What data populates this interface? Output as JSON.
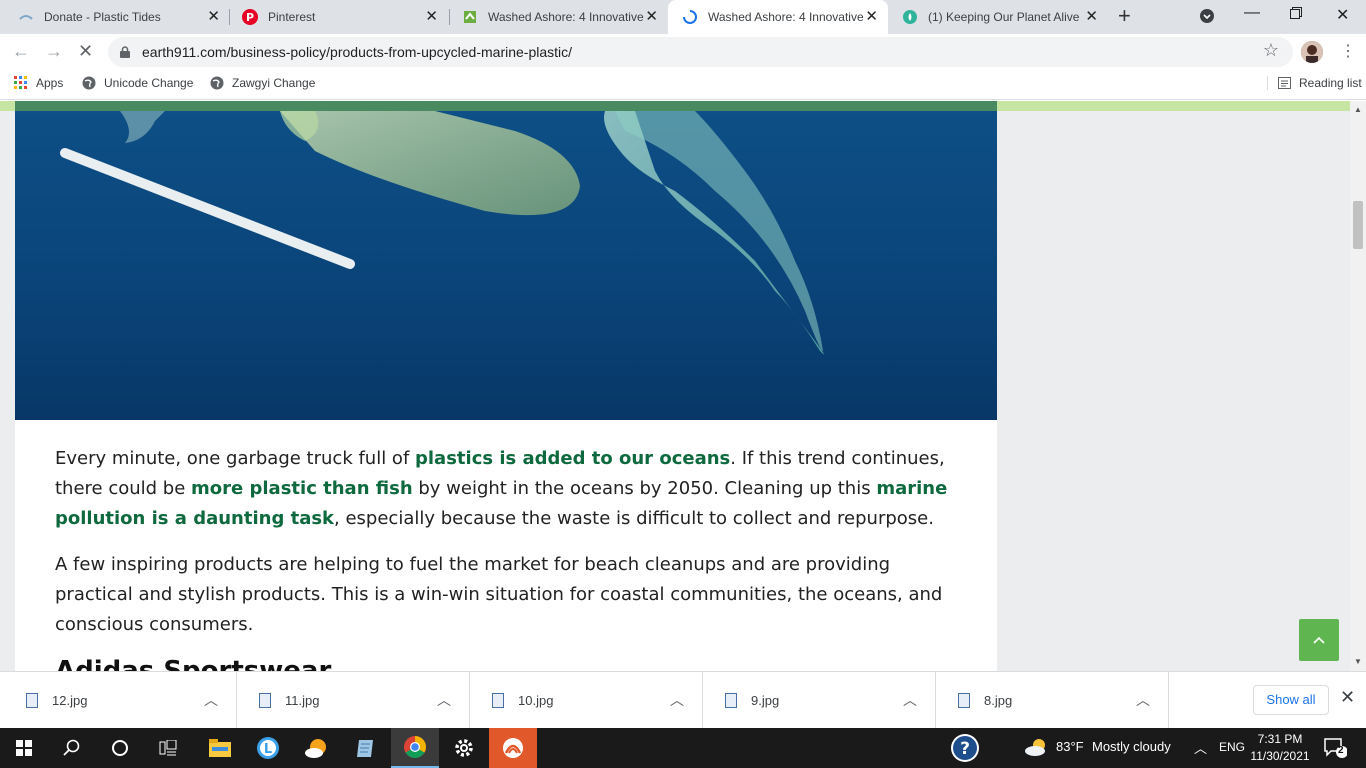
{
  "tabs": [
    {
      "title": "Donate - Plastic Tides",
      "favicon": "plastic-tides-icon"
    },
    {
      "title": "Pinterest",
      "favicon": "pinterest-icon"
    },
    {
      "title": "Washed Ashore: 4 Innovative",
      "favicon": "earth911-icon"
    },
    {
      "title": "Washed Ashore: 4 Innovative",
      "favicon": "loading-spinner-icon"
    },
    {
      "title": "(1) Keeping Our Planet Alive",
      "favicon": "planet-icon"
    }
  ],
  "address_bar": {
    "url": "earth911.com/business-policy/products-from-upcycled-marine-plastic/"
  },
  "bookmarks": {
    "apps": "Apps",
    "items": [
      "Unicode Change",
      "Zawgyi Change"
    ],
    "reading_list": "Reading list"
  },
  "article": {
    "p1": {
      "t1": "Every minute, one garbage truck full of ",
      "l1": "plastics is added to our oceans",
      "t2": ". If this trend continues, there could be ",
      "l2": "more plastic than fish",
      "t3": " by weight in the oceans by 2050. Cleaning up this ",
      "l3": "marine pollution is a daunting task",
      "t4": ", especially because the waste is difficult to collect and repurpose."
    },
    "p2": "A few inspiring products are helping to fuel the market for beach cleanups and are providing practical and stylish products. This is a win-win situation for coastal communities, the oceans, and conscious consumers.",
    "heading": "Adidas Sportswear"
  },
  "downloads": {
    "files": [
      "12.jpg",
      "11.jpg",
      "10.jpg",
      "9.jpg",
      "8.jpg"
    ],
    "show_all": "Show all"
  },
  "taskbar": {
    "weather_temp": "83°F",
    "weather_desc": "Mostly cloudy",
    "lang": "ENG",
    "time": "7:31 PM",
    "date": "11/30/2021",
    "notifications": "2"
  },
  "colors": {
    "link": "#0e6a3e",
    "accent_green": "#5fb650",
    "ocean": "#0d4f86"
  }
}
